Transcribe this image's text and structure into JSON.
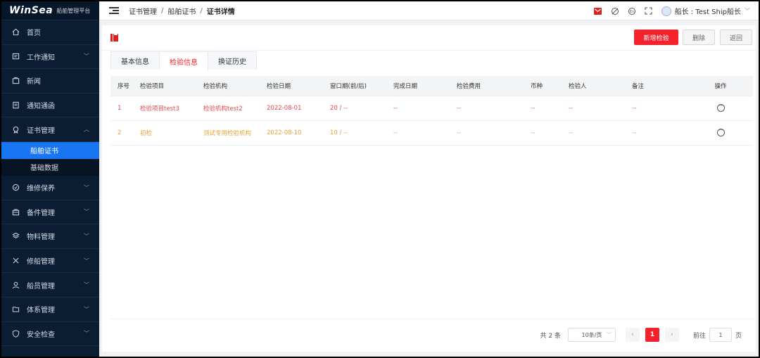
{
  "app": {
    "brand": "WinSea",
    "subtitle": "船舶管理平台"
  },
  "sidebar": {
    "items": [
      {
        "label": "首页",
        "icon": "home-icon"
      },
      {
        "label": "工作通知",
        "icon": "notice-icon",
        "expandable": true
      },
      {
        "label": "新闻",
        "icon": "news-icon"
      },
      {
        "label": "通知通函",
        "icon": "circular-icon"
      },
      {
        "label": "证书管理",
        "icon": "certificate-icon",
        "expanded": true,
        "children": [
          {
            "label": "船舶证书",
            "active": true
          },
          {
            "label": "基础数据"
          }
        ]
      },
      {
        "label": "维修保养",
        "icon": "maintenance-icon",
        "expandable": true
      },
      {
        "label": "备件管理",
        "icon": "spare-parts-icon",
        "expandable": true
      },
      {
        "label": "物料管理",
        "icon": "materials-icon",
        "expandable": true
      },
      {
        "label": "修船管理",
        "icon": "repair-icon",
        "expandable": true
      },
      {
        "label": "船员管理",
        "icon": "crew-icon",
        "expandable": true
      },
      {
        "label": "体系管理",
        "icon": "system-icon",
        "expandable": true
      },
      {
        "label": "安全检查",
        "icon": "safety-icon",
        "expandable": true
      }
    ]
  },
  "header": {
    "breadcrumb": [
      "证书管理",
      "船舶证书",
      "证书详情"
    ],
    "separator": "/",
    "user": "船长 : Test Ship船长"
  },
  "toolbar": {
    "add_label": "新增检验",
    "delete_label": "删除",
    "back_label": "返回"
  },
  "tabs": [
    {
      "label": "基本信息",
      "active": false
    },
    {
      "label": "检验信息",
      "active": true
    },
    {
      "label": "换证历史",
      "active": false
    }
  ],
  "table": {
    "headers": [
      "序号",
      "检验项目",
      "检验机构",
      "检验日期",
      "窗口期(前/后)",
      "完成日期",
      "检验费用",
      "币种",
      "检验人",
      "备注",
      "操作"
    ],
    "rows": [
      [
        "1",
        "检验项目test3",
        "检验机构test2",
        "2022-08-01",
        "20 / --",
        "--",
        "--",
        "--",
        "--",
        "--"
      ],
      [
        "2",
        "初检",
        "测试专用检验机构",
        "2022-08-10",
        "10 / --",
        "--",
        "--",
        "--",
        "--",
        "--"
      ]
    ]
  },
  "pagination": {
    "total": "共 2 条",
    "page_size": "10条/页",
    "current_page": "1",
    "goto_label": "前往",
    "goto_value": "1",
    "page_suffix": "页",
    "prev": "‹",
    "next": "›"
  },
  "colors": {
    "accent": "#f5222d",
    "sidebar_bg": "#0b1d33",
    "active_menu": "#1976f2",
    "row1_text": "#e8484f",
    "row2_text": "#e8a33a"
  }
}
